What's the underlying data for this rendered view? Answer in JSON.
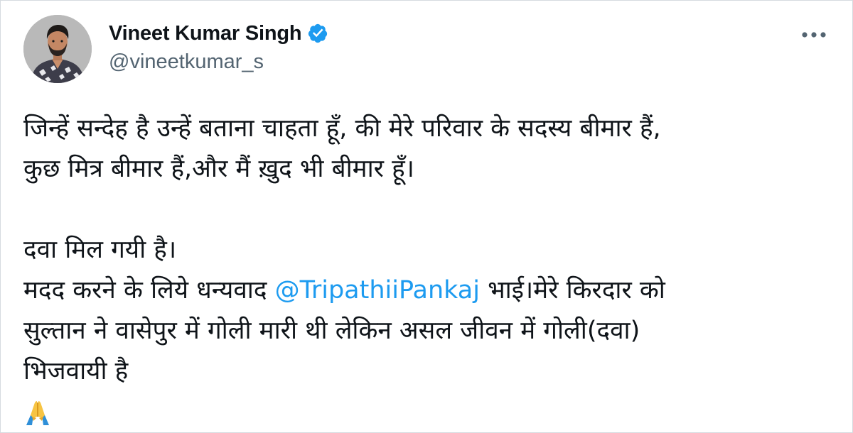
{
  "author": {
    "name": "Vineet Kumar Singh",
    "handle": "@vineetkumar_s",
    "verified": true,
    "verified_icon": "verified-badge-icon",
    "avatar_icon": "profile-photo"
  },
  "menu": {
    "icon": "more-options-icon"
  },
  "tweet": {
    "line1": "जिन्हें सन्देह है उन्हें बताना चाहता हूँ, की मेरे परिवार के सदस्य बीमार हैं,",
    "line2": "कुछ मित्र बीमार हैं,और मैं ख़ुद भी बीमार हूँ।",
    "line3": "दवा मिल गयी है।",
    "line4_before": "मदद करने के लिये धन्यवाद ",
    "mention": "@TripathiiPankaj",
    "line4_after": " भाई।मेरे किरदार को",
    "line5": "सुल्तान ने वासेपुर में गोली मारी थी लेकिन असल जीवन में गोली(दवा)",
    "line6": "भिजवायी है",
    "emoji": "🙏",
    "emoji_icon": "folded-hands-emoji"
  },
  "colors": {
    "link": "#1d9bf0",
    "verified": "#1d9bf0",
    "text": "#0f1419",
    "secondary": "#536471"
  }
}
